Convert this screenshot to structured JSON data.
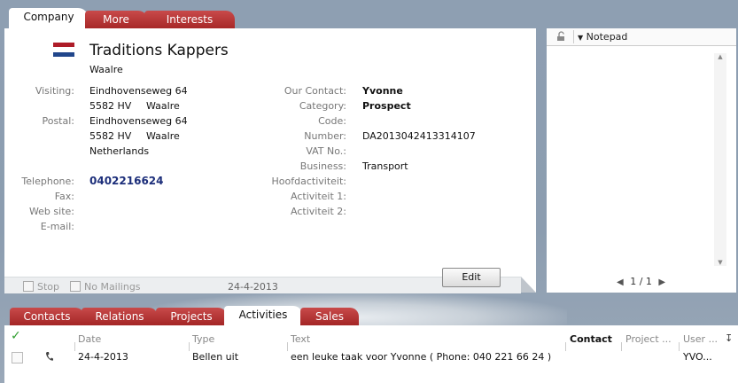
{
  "top_tabs": [
    {
      "label": "Company"
    },
    {
      "label": "More"
    },
    {
      "label": "Interests"
    }
  ],
  "company": {
    "name": "Traditions Kappers",
    "city": "Waalre",
    "visiting_label": "Visiting:",
    "visiting_line1": "Eindhovenseweg 64",
    "visiting_zip": "5582 HV",
    "visiting_city": "Waalre",
    "postal_label": "Postal:",
    "postal_line1": "Eindhovenseweg 64",
    "postal_zip": "5582 HV",
    "postal_city": "Waalre",
    "postal_country": "Netherlands",
    "telephone_label": "Telephone:",
    "telephone": "0402216624",
    "fax_label": "Fax:",
    "website_label": "Web site:",
    "email_label": "E-mail:",
    "our_contact_label": "Our Contact:",
    "our_contact": "Yvonne",
    "category_label": "Category:",
    "category": "Prospect",
    "code_label": "Code:",
    "number_label": "Number:",
    "number": "DA2013042413314107",
    "vat_label": "VAT No.:",
    "business_label": "Business:",
    "business": "Transport",
    "hoofd_label": "Hoofdactiviteit:",
    "act1_label": "Activiteit 1:",
    "act2_label": "Activiteit 2:",
    "stop_label": "Stop",
    "nomailings_label": "No Mailings",
    "updated": "24-4-2013",
    "edit_label": "Edit",
    "flag_colors": [
      "#ae1c28",
      "#ffffff",
      "#21468b"
    ]
  },
  "notepad": {
    "title": "Notepad",
    "pager": "1 / 1"
  },
  "bottom_tabs": [
    {
      "label": "Contacts"
    },
    {
      "label": "Relations"
    },
    {
      "label": "Projects"
    },
    {
      "label": "Activities"
    },
    {
      "label": "Sales"
    }
  ],
  "activities": {
    "columns": {
      "date": "Date",
      "type": "Type",
      "text": "Text",
      "contact": "Contact",
      "project": "Project ...",
      "user": "User ..."
    },
    "rows": [
      {
        "date": "24-4-2013",
        "type": "Bellen uit",
        "text": "een leuke taak voor Yvonne ( Phone: 040 221 66 24 )",
        "contact": "",
        "project": "",
        "user": "YVO..."
      }
    ]
  }
}
